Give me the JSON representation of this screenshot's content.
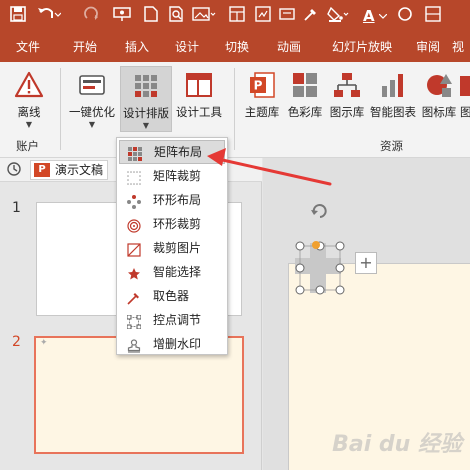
{
  "qat": {
    "icons": [
      "save-icon",
      "undo-icon",
      "redo-icon",
      "present-icon",
      "new-icon",
      "find-icon",
      "picture-icon",
      "layout-icon",
      "gallery-icon",
      "slide-icon",
      "eyedropper-icon",
      "fill-icon",
      "font-color-icon",
      "shape-circle-icon",
      "more-icon"
    ],
    "font_color_label": "A"
  },
  "tabs": [
    "文件",
    "开始",
    "插入",
    "设计",
    "切换",
    "动画",
    "幻灯片放映",
    "审阅",
    "视"
  ],
  "ribbon": {
    "offline_label": "离线",
    "optimize_label": "一键优化",
    "design_layout_label": "设计排版",
    "design_tools_label": "设计工具",
    "theme_label": "主题库",
    "color_label": "色彩库",
    "diagram_label": "图示库",
    "smart_chart_label": "智能图表",
    "icon_lib_label": "图标库",
    "more_label": "图",
    "group_account": "账户",
    "group_resources": "资源"
  },
  "panel": {
    "doc_tab_label": "演示文稿",
    "doc_tab_badge": "P",
    "slide_1_number": "1",
    "slide_2_number": "2"
  },
  "dropdown": {
    "items": [
      "矩阵布局",
      "矩阵裁剪",
      "环形布局",
      "环形裁剪",
      "裁剪图片",
      "智能选择",
      "取色器",
      "控点调节",
      "增删水印"
    ]
  },
  "watermark": "Bai du 经验",
  "colors": {
    "brand": "#b7472a",
    "arrow": "#e53935",
    "slide_bg": "#fef6e4",
    "selected_slide_border": "#e8735a"
  }
}
